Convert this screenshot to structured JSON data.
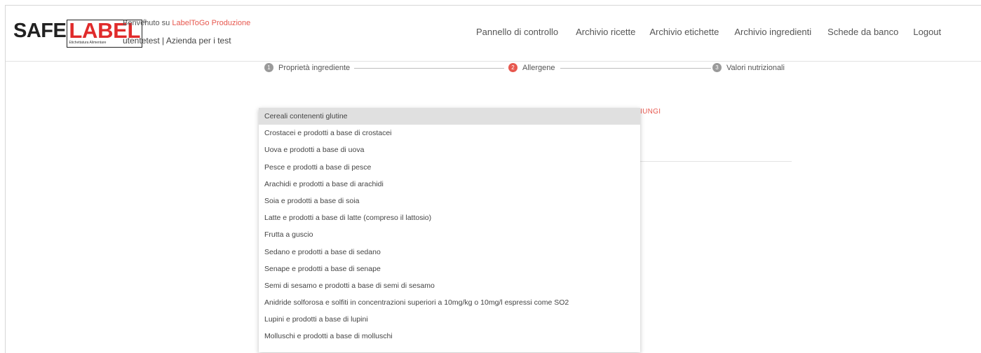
{
  "header": {
    "logo": {
      "safe": "SAFE",
      "label": "LABEL",
      "reg": "®",
      "tagline": "Etichettatura Alimentare"
    },
    "welcome_prefix": "Benvenuto su ",
    "app_name": "LabelToGo Produzione",
    "user_line": "utentetest | Azienda per i test"
  },
  "nav": {
    "items": [
      "Pannello di controllo",
      "Archivio ricette",
      "Archivio etichette",
      "Archivio ingredienti",
      "Schede da banco",
      "Logout"
    ]
  },
  "stepper": {
    "steps": [
      {
        "num": "1",
        "label": "Proprietà ingrediente",
        "active": false
      },
      {
        "num": "2",
        "label": "Allergene",
        "active": true
      },
      {
        "num": "3",
        "label": "Valori nutrizionali",
        "active": false
      }
    ],
    "accent": "#e7584f"
  },
  "peek_button": "IUNGI",
  "dropdown": {
    "selected_index": 0,
    "options": [
      "Cereali contenenti glutine",
      "Crostacei e prodotti a base di crostacei",
      "Uova e prodotti a base di uova",
      "Pesce e prodotti a base di pesce",
      "Arachidi e prodotti a base di arachidi",
      "Soia e prodotti a base di soia",
      "Latte e prodotti a base di latte (compreso il lattosio)",
      "Frutta a guscio",
      "Sedano e prodotti a base di sedano",
      "Senape e prodotti a base di senape",
      "Semi di sesamo e prodotti a base di semi di sesamo",
      "Anidride solforosa e solfiti in concentrazioni superiori a 10mg/kg o 10mg/l espressi come SO2",
      "Lupini e prodotti a base di lupini",
      "Molluschi e prodotti a base di molluschi"
    ]
  }
}
